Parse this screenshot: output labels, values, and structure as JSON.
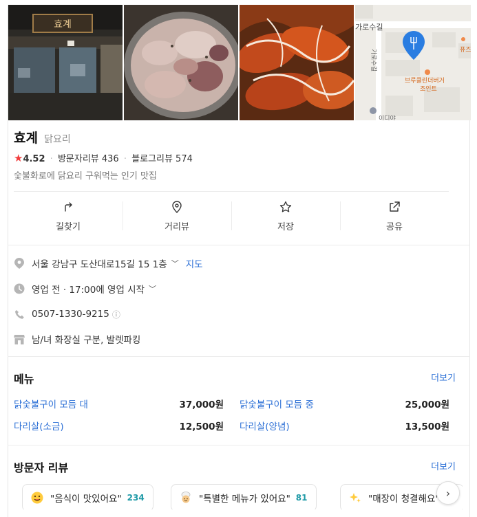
{
  "place": {
    "name": "효계",
    "category": "닭요리",
    "rating": "4.52",
    "visitor_reviews": "방문자리뷰 436",
    "blog_reviews": "블로그리뷰 574",
    "description": "숯불화로에 닭요리 구워먹는 인기 맛집"
  },
  "photos": {
    "sign_text": "효계",
    "map_street_label": "가로수길",
    "map_street_label_vertical": "가로수길",
    "map_poi": "브루클린더버거\n조인트",
    "map_poi_line1": "브루클린더버거",
    "map_poi_line2": "조인트",
    "map_edge_label": "퓨즈",
    "map_bottom_label": "이디야"
  },
  "actions": [
    {
      "label": "길찾기",
      "icon": "directions-icon"
    },
    {
      "label": "거리뷰",
      "icon": "street-view-icon"
    },
    {
      "label": "저장",
      "icon": "star-outline-icon"
    },
    {
      "label": "공유",
      "icon": "share-icon"
    }
  ],
  "details": {
    "address": "서울 강남구 도산대로15길 15 1층",
    "map_link": "지도",
    "hours": "영업 전 · 17:00에 영업 시작",
    "phone": "0507-1330-9215",
    "amenities": "남/녀 화장실 구분, 발렛파킹"
  },
  "menu": {
    "title": "메뉴",
    "more": "더보기",
    "items": [
      {
        "name": "닭숯불구이 모듬 대",
        "price": "37,000원"
      },
      {
        "name": "닭숯불구이 모듬 중",
        "price": "25,000원"
      },
      {
        "name": "다리살(소금)",
        "price": "12,500원"
      },
      {
        "name": "다리살(양념)",
        "price": "13,500원"
      }
    ]
  },
  "reviews": {
    "title": "방문자 리뷰",
    "more": "더보기",
    "chips": [
      {
        "text": "\"음식이 맛있어요\"",
        "count": "234",
        "icon": "yum-face-icon"
      },
      {
        "text": "\"특별한 메뉴가 있어요\"",
        "count": "81",
        "icon": "chef-icon"
      },
      {
        "text": "\"매장이 청결해요\"",
        "count": "",
        "icon": "sparkle-icon"
      }
    ]
  },
  "colors": {
    "accent_blue": "#2b6fd6",
    "star_red": "#f23c3c",
    "count_teal": "#1f9aa7",
    "map_pin": "#2a7de1"
  }
}
